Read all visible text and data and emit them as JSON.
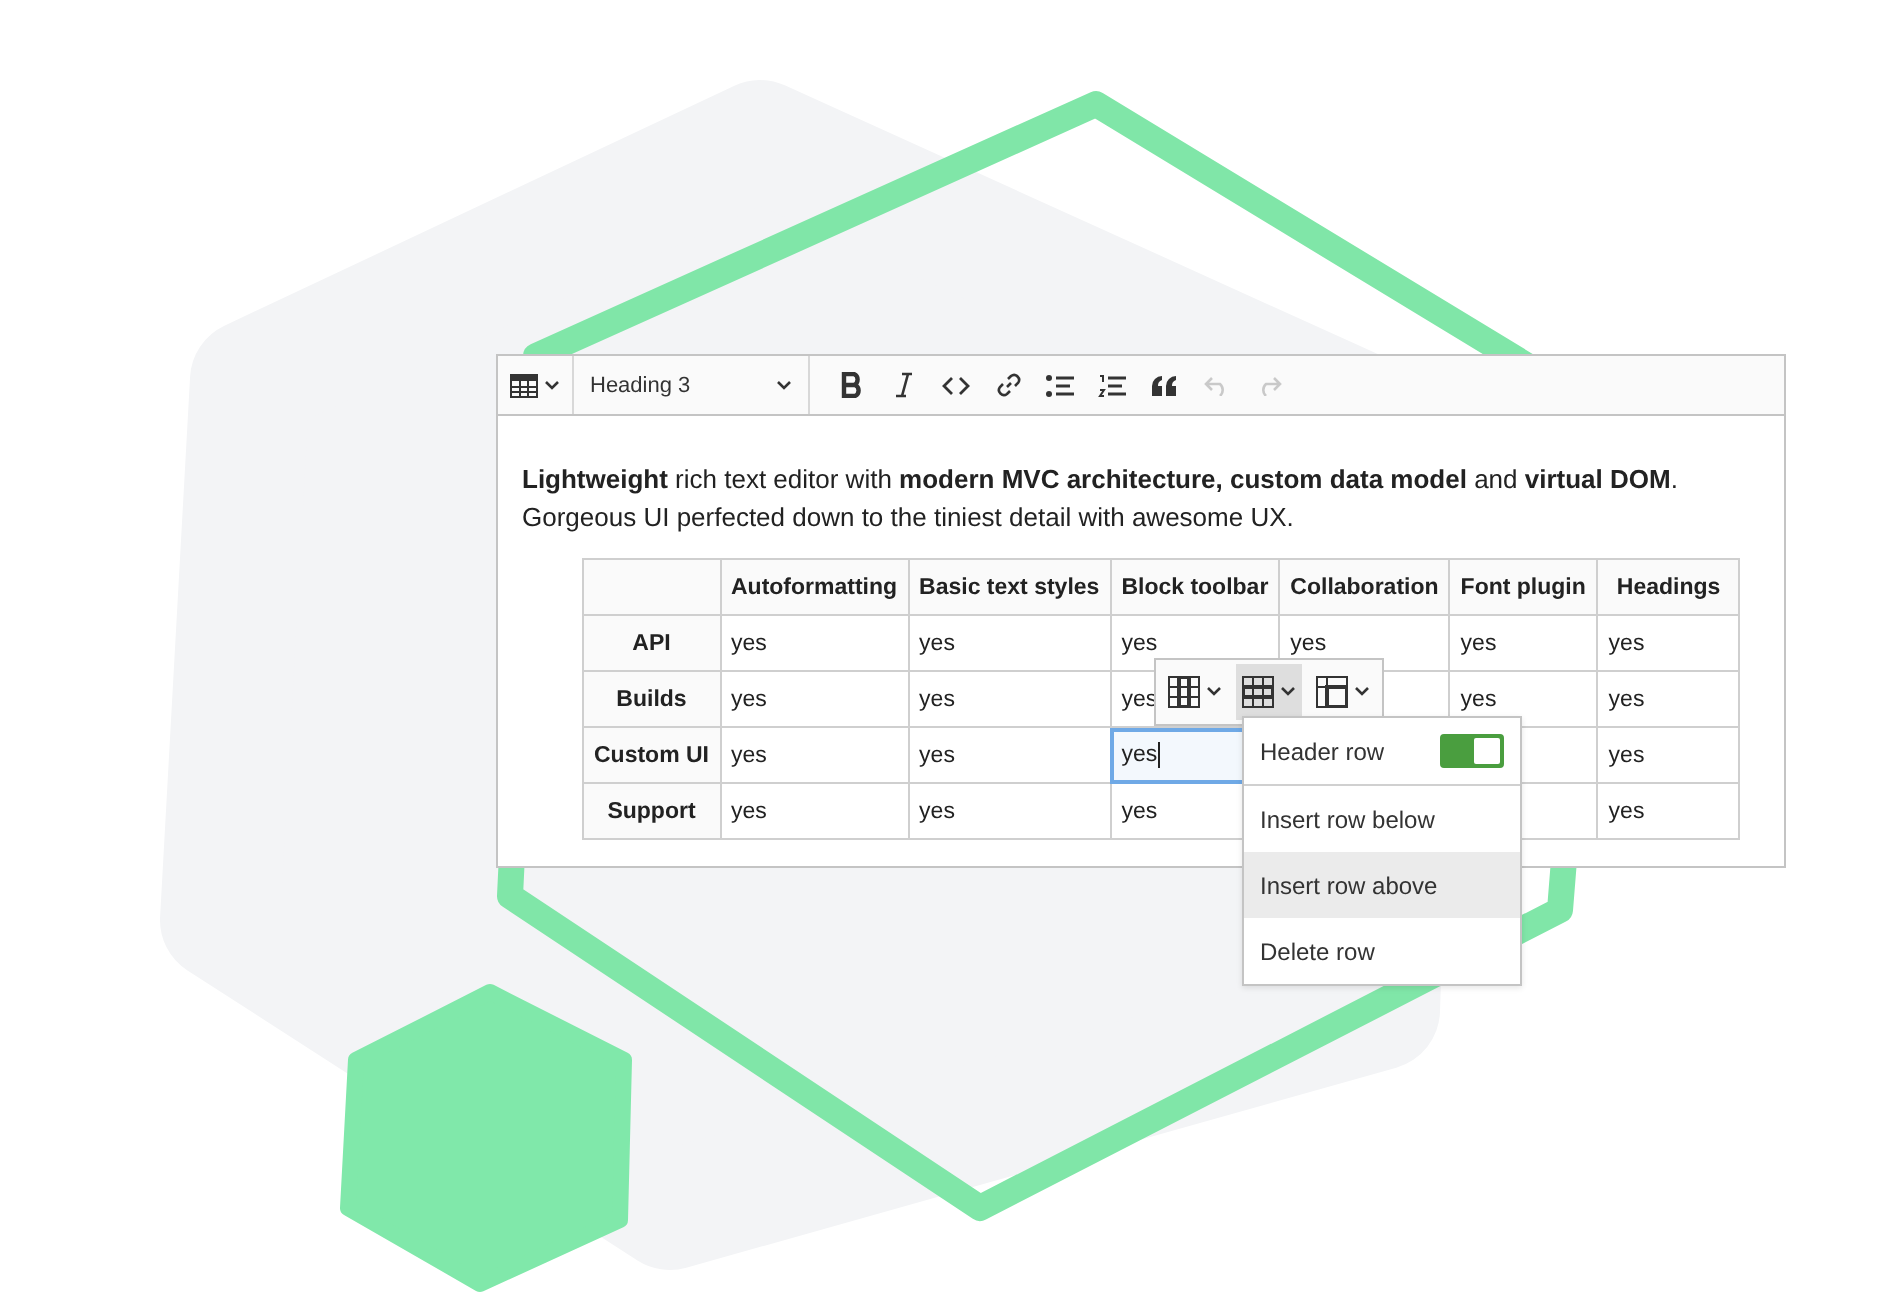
{
  "editor": {
    "toolbar": [
      {
        "kind": "insert-table",
        "disabled": false
      },
      {
        "kind": "heading",
        "label": "Heading 3",
        "disabled": false
      },
      {
        "kind": "bold",
        "disabled": false
      },
      {
        "kind": "italic",
        "disabled": false
      },
      {
        "kind": "code",
        "disabled": false
      },
      {
        "kind": "link",
        "disabled": false
      },
      {
        "kind": "bulleted-list",
        "disabled": false
      },
      {
        "kind": "numbered-list",
        "disabled": false
      },
      {
        "kind": "block-quote",
        "disabled": false
      },
      {
        "kind": "undo",
        "disabled": true
      },
      {
        "kind": "redo",
        "disabled": true
      }
    ],
    "paragraph": "**Lightweight** rich text editor with **modern MVC architecture, custom data model** and **virtual DOM**. Gorgeous UI perfected down to the tiniest detail with awesome UX.",
    "table": {
      "columns": [
        "",
        "Autoformatting",
        "Basic text styles",
        "Block toolbar",
        "Collaboration",
        "Font plugin",
        "Headings"
      ],
      "rows": [
        {
          "cells": [
            {
              "text": "API",
              "focused": false
            },
            {
              "text": "yes",
              "focused": false
            },
            {
              "text": "yes",
              "focused": false
            },
            {
              "text": "yes",
              "focused": false
            },
            {
              "text": "yes",
              "focused": false
            },
            {
              "text": "yes",
              "focused": false
            },
            {
              "text": "yes",
              "focused": false
            }
          ]
        },
        {
          "cells": [
            {
              "text": "Builds",
              "focused": false
            },
            {
              "text": "yes",
              "focused": false
            },
            {
              "text": "yes",
              "focused": false
            },
            {
              "text": "yes",
              "focused": false
            },
            null,
            {
              "text": "yes",
              "focused": false
            },
            {
              "text": "yes",
              "focused": false
            }
          ]
        },
        {
          "cells": [
            {
              "text": "Custom UI",
              "focused": false
            },
            {
              "text": "yes",
              "focused": false
            },
            {
              "text": "yes",
              "focused": false
            },
            {
              "text": "yes",
              "focused": true
            },
            null,
            null,
            {
              "text": "yes",
              "focused": false
            }
          ]
        },
        {
          "cells": [
            {
              "text": "Support",
              "focused": false
            },
            {
              "text": "yes",
              "focused": false
            },
            {
              "text": "yes",
              "focused": false
            },
            {
              "text": "yes",
              "focused": false
            },
            null,
            null,
            {
              "text": "yes",
              "focused": false
            }
          ]
        }
      ]
    },
    "table_toolbar": [
      {
        "kind": "column",
        "on": false
      },
      {
        "kind": "row",
        "on": true
      },
      {
        "kind": "merge",
        "on": false
      }
    ],
    "row_menu": [
      {
        "kind": "switch",
        "label": "Header row",
        "on": true
      },
      {
        "kind": "item",
        "label": "Insert row below",
        "highlighted": false
      },
      {
        "kind": "item",
        "label": "Insert row above",
        "highlighted": true
      },
      {
        "kind": "item",
        "label": "Delete row",
        "highlighted": false
      }
    ]
  }
}
